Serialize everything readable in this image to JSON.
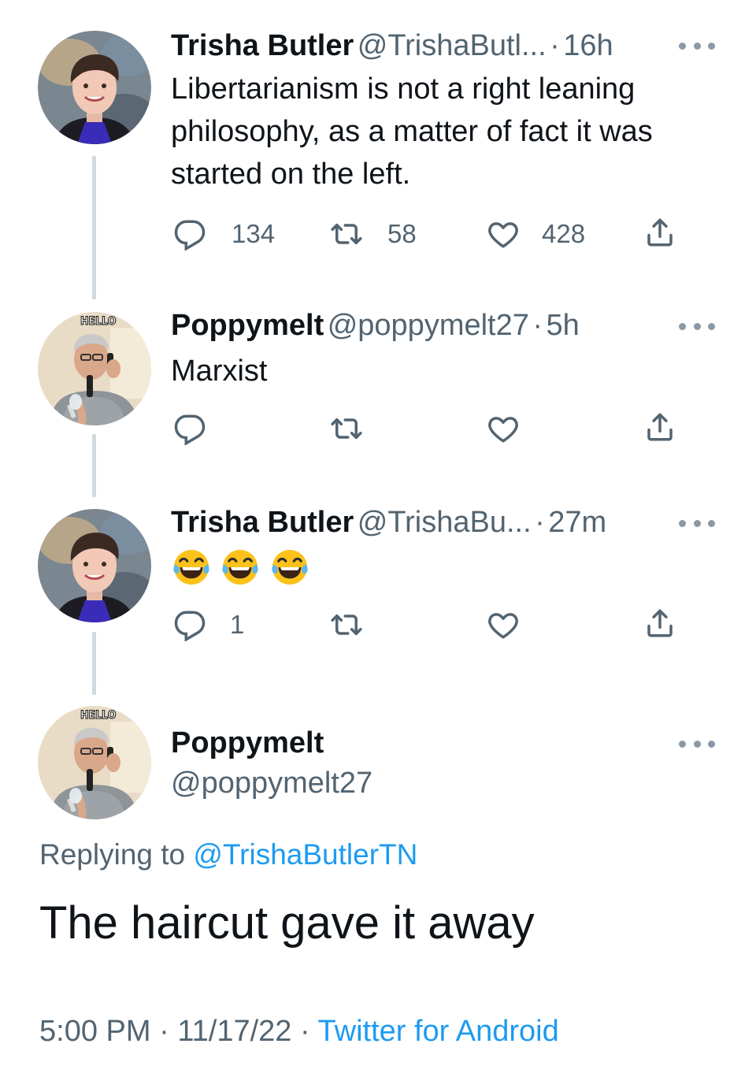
{
  "colors": {
    "text_primary": "#0f1419",
    "text_secondary": "#536471",
    "link": "#1d9bf0",
    "thread_line": "#cfd9de",
    "icon": "#536471"
  },
  "tweets": [
    {
      "name": "Trisha Butler",
      "handle": "@TrishaButl...",
      "separator": "·",
      "time": "16h",
      "text": "Libertarianism is not a right leaning philosophy, as a matter of fact it was started on the left.",
      "reply_count": "134",
      "retweet_count": "58",
      "like_count": "428"
    },
    {
      "name": "Poppymelt",
      "handle": "@poppymelt27",
      "separator": "·",
      "time": "5h",
      "text": "Marxist",
      "avatar_badge": "HELLO",
      "reply_count": "",
      "retweet_count": "",
      "like_count": ""
    },
    {
      "name": "Trisha Butler",
      "handle": "@TrishaBu...",
      "separator": "·",
      "time": "27m",
      "emojis": [
        "face-with-tears-of-joy",
        "face-with-tears-of-joy",
        "face-with-tears-of-joy"
      ],
      "reply_count": "1",
      "retweet_count": "",
      "like_count": ""
    }
  ],
  "focused_tweet": {
    "name": "Poppymelt",
    "handle": "@poppymelt27",
    "avatar_badge": "HELLO",
    "replying_prefix": "Replying to",
    "replying_handle": "@TrishaButlerTN",
    "text": "The haircut gave it away",
    "time": "5:00 PM",
    "separator1": "·",
    "date": "11/17/22",
    "separator2": "·",
    "source": "Twitter for Android"
  },
  "icons": [
    "reply-icon",
    "retweet-icon",
    "like-icon",
    "share-icon",
    "more-icon"
  ]
}
